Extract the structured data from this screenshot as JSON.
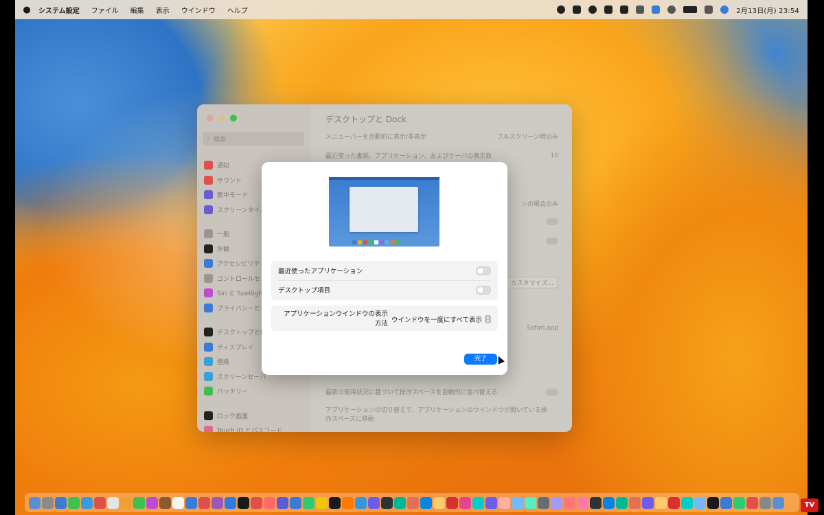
{
  "menubar": {
    "app": "システム設定",
    "items": [
      "ファイル",
      "編集",
      "表示",
      "ウインドウ",
      "ヘルプ"
    ],
    "clock": "2月13日(月) 23:54"
  },
  "settings": {
    "search_placeholder": "検索",
    "sidebar": [
      {
        "label": "通知",
        "color": "#e0504a"
      },
      {
        "label": "サウンド",
        "color": "#e0504a"
      },
      {
        "label": "集中モード",
        "color": "#6a5bd0"
      },
      {
        "label": "スクリーンタイム",
        "color": "#6a5bd0"
      },
      {
        "label": "一般",
        "color": "#9a9590"
      },
      {
        "label": "外観",
        "color": "#222222"
      },
      {
        "label": "アクセシビリティ",
        "color": "#3a7bd5"
      },
      {
        "label": "コントロールセンター",
        "color": "#9a9590"
      },
      {
        "label": "Siri と Spotlight",
        "color": "#c04ad0"
      },
      {
        "label": "プライバシーとセキュリティ",
        "color": "#3a7bd5"
      },
      {
        "label": "デスクトップとDock",
        "color": "#222222"
      },
      {
        "label": "ディスプレイ",
        "color": "#3a7bd5"
      },
      {
        "label": "壁紙",
        "color": "#3aa0d5"
      },
      {
        "label": "スクリーンセーバ",
        "color": "#3aa0d5"
      },
      {
        "label": "バッテリー",
        "color": "#3fbf4c"
      },
      {
        "label": "ロック画面",
        "color": "#222222"
      },
      {
        "label": "Touch ID とパスコード",
        "color": "#e06a8a"
      }
    ],
    "title": "デスクトップと Dock",
    "rows": {
      "menubar_autohide_label": "メニューバーを自動的に表示/非表示",
      "menubar_autohide_value": "フルスクリーン時のみ",
      "recent_items_label": "最近使った書類、アプリケーション、およびサーバの表示数",
      "recent_items_value": "10",
      "tabs_value": "ンの場合のみ",
      "customize_button": "カスタマイズ...",
      "browser_value": "Safari.app",
      "rearrange_spaces_label": "最新の使用状況に基づいて操作スペースを自動的に並べ替える",
      "switch_spaces_label": "アプリケーションの切り替えで、アプリケーションのウインドウが開いている操作スペースに移動"
    }
  },
  "dialog": {
    "recent_apps_label": "最近使ったアプリケーション",
    "desktop_items_label": "デスクトップ項目",
    "window_display_label": "アプリケーションウインドウの表示方法",
    "window_display_value": "ウインドウを一度にすべて表示",
    "done_button": "完了",
    "preview_dock_colors": [
      "#3a7bd5",
      "#f0b400",
      "#e0504a",
      "#3fbf4c",
      "#ffffff",
      "#8c6cd8",
      "#5ab0e0",
      "#e07a3a",
      "#3fbf4c"
    ]
  },
  "dock_colors": [
    "#5a8fd8",
    "#8a8a8a",
    "#3a7bd5",
    "#3fbf4c",
    "#3a9ae0",
    "#e0504a",
    "#e5e5e5",
    "#f0a030",
    "#3fbf4c",
    "#c04ad0",
    "#8b5a2b",
    "#f5f5f5",
    "#3a7bd5",
    "#e0504a",
    "#9b59b6",
    "#2d7be5",
    "#1a1a1a",
    "#e0504a",
    "#ff6b6b",
    "#5b5bd6",
    "#3a7bd5",
    "#2ecc71",
    "#f1c40f",
    "#1a1a1a",
    "#ff7a00",
    "#3498db",
    "#6c5ce7",
    "#2d3436",
    "#00b894",
    "#e17055",
    "#0984e3",
    "#fdcb6e",
    "#d63031",
    "#e84393",
    "#00cec9",
    "#6c5ce7",
    "#fab1a0",
    "#74b9ff",
    "#55efc4",
    "#636e72",
    "#a29bfe",
    "#ff7675",
    "#fd79a8",
    "#2d3436",
    "#0984e3",
    "#00b894",
    "#e17055",
    "#6c5ce7",
    "#fdcb6e",
    "#d63031",
    "#00cec9",
    "#74b9ff",
    "#1a1a1a",
    "#3a7bd5",
    "#2ecc71",
    "#e0504a",
    "#888888",
    "#5a8fd8"
  ],
  "watermark": "TV"
}
